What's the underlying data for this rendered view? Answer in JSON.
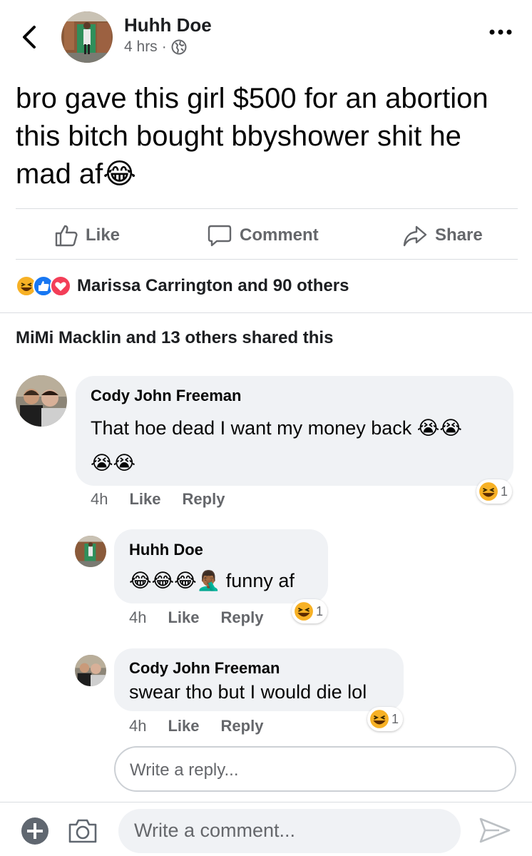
{
  "post": {
    "author": "Huhh Doe",
    "time": "4 hrs",
    "separator": "·",
    "text": "bro gave this girl $500 for an abortion this bitch bought bbyshower shit he mad af",
    "text_emoji": "😂"
  },
  "actions": {
    "like": "Like",
    "comment": "Comment",
    "share": "Share"
  },
  "reactions": {
    "summary": "Marissa Carrington and 90 others",
    "types": [
      "haha",
      "like",
      "love"
    ]
  },
  "shares": "MiMi Macklin and 13 others shared this",
  "comments": [
    {
      "author": "Cody John Freeman",
      "text": "That hoe dead I want my money back",
      "emoji_line1": "😭😭",
      "emoji_line2": "😭😭",
      "time": "4h",
      "like": "Like",
      "reply": "Reply",
      "reaction_count": "1"
    },
    {
      "author": "Huhh Doe",
      "emoji": "😂😂😂🤦🏾‍♂️",
      "text": "funny af",
      "time": "4h",
      "like": "Like",
      "reply": "Reply",
      "reaction_count": "1"
    },
    {
      "author": "Cody John Freeman",
      "text": "swear tho but I would die lol",
      "time": "4h",
      "like": "Like",
      "reply": "Reply",
      "reaction_count": "1"
    }
  ],
  "reply_placeholder": "Write a reply...",
  "comment_placeholder": "Write a comment...",
  "colors": {
    "facebook_blue": "#1877f2",
    "love_red": "#f33e58",
    "haha_yellow": "#f7b125",
    "secondary_text": "#65676b"
  }
}
